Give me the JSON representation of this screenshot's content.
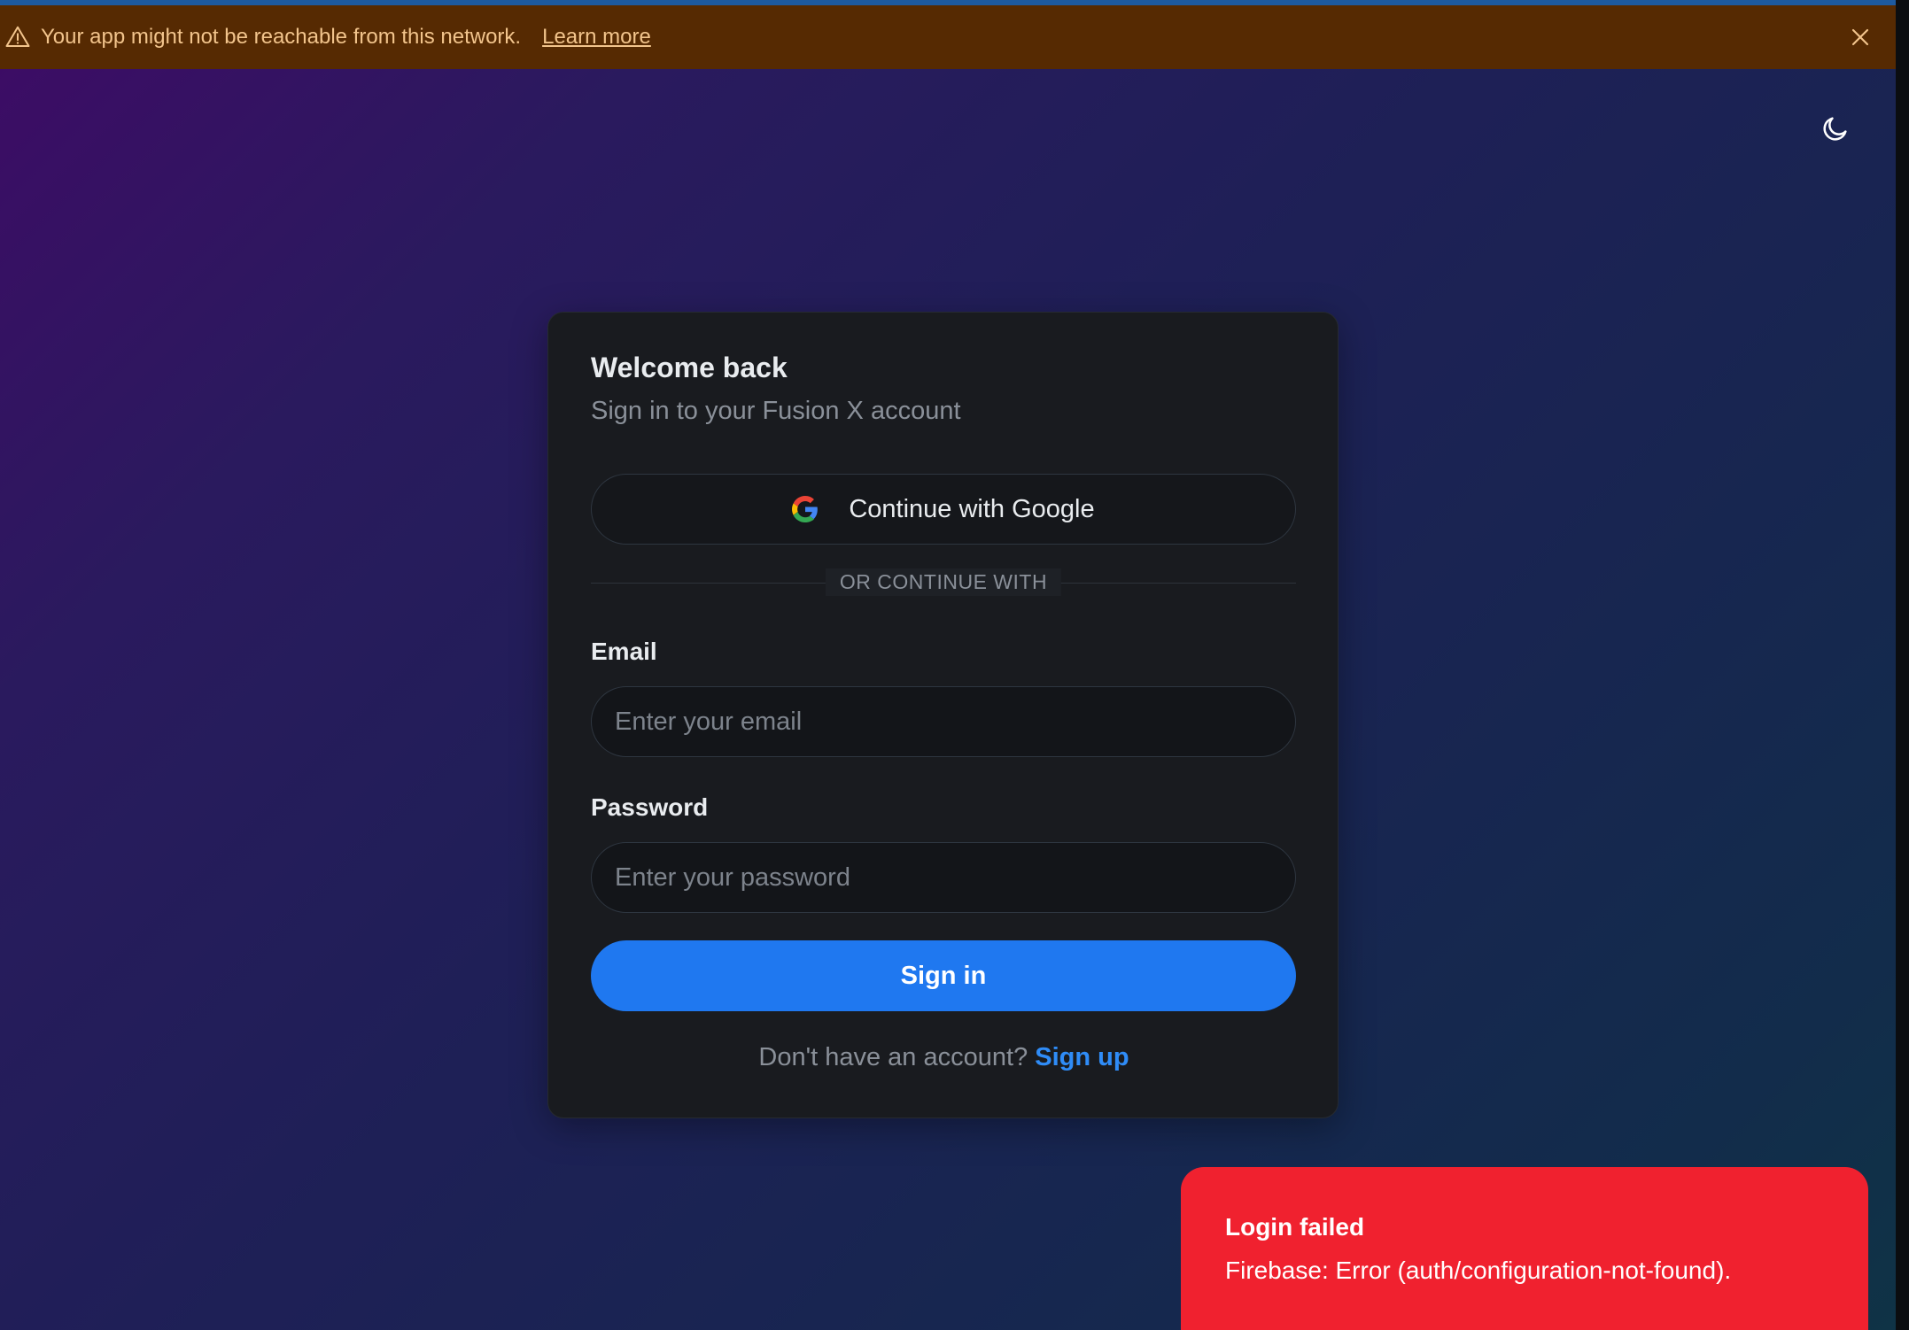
{
  "banner": {
    "message": "Your app might not be reachable from this network.",
    "link": "Learn more",
    "warning_icon": "warning-triangle-icon",
    "close_icon": "close-icon"
  },
  "theme_toggle": {
    "icon": "moon-icon"
  },
  "login": {
    "title": "Welcome back",
    "subtitle": "Sign in to your Fusion X account",
    "google_button": "Continue with Google",
    "divider": "OR CONTINUE WITH",
    "email_label": "Email",
    "email_placeholder": "Enter your email",
    "password_label": "Password",
    "password_placeholder": "Enter your password",
    "signin_button": "Sign in",
    "signup_prompt": "Don't have an account?",
    "signup_link": "Sign up"
  },
  "toast": {
    "title": "Login failed",
    "description": "Firebase: Error (auth/configuration-not-found)."
  },
  "colors": {
    "banner_bg": "#562a02",
    "primary": "#1f78f0",
    "error": "#f0212f",
    "card_bg": "#191b1f"
  }
}
